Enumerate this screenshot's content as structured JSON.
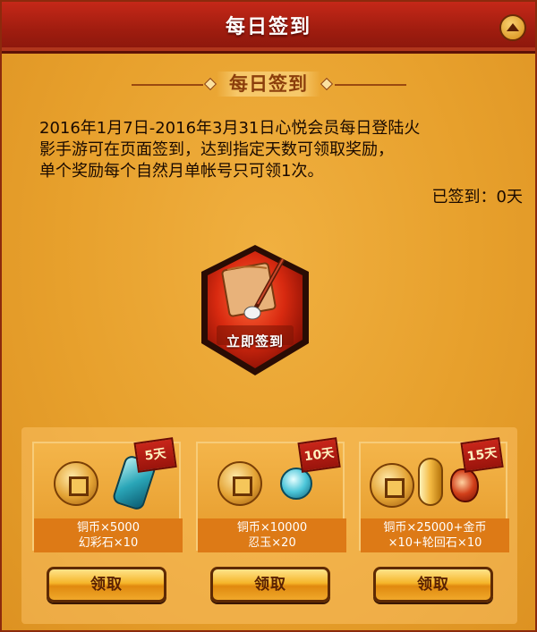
{
  "header": {
    "title": "每日签到"
  },
  "section": {
    "title": "每日签到"
  },
  "description": {
    "lines": [
      "2016年1月7日-2016年3月31日心悦会员每日登陆火",
      "影手游可在页面签到，达到指定天数可领取奖励，",
      "单个奖励每个自然月单帐号只可领1次。"
    ]
  },
  "status": {
    "signed_days_text": "已签到：0天"
  },
  "sign_button": {
    "label": "立即签到"
  },
  "rewards": [
    {
      "days": "5天",
      "line1": "铜币×5000",
      "line2": "幻彩石×10",
      "claim": "领取"
    },
    {
      "days": "10天",
      "line1": "铜币×10000",
      "line2": "忍玉×20",
      "claim": "领取"
    },
    {
      "days": "15天",
      "line1": "铜币×25000+金币",
      "line2": "×10+轮回石×10",
      "claim": "领取"
    }
  ],
  "colors": {
    "header_red": "#9e1c0f",
    "panel_orange": "#e9a22e",
    "section_brown": "#8b3e0c",
    "button_gold": "#f5b52a"
  }
}
